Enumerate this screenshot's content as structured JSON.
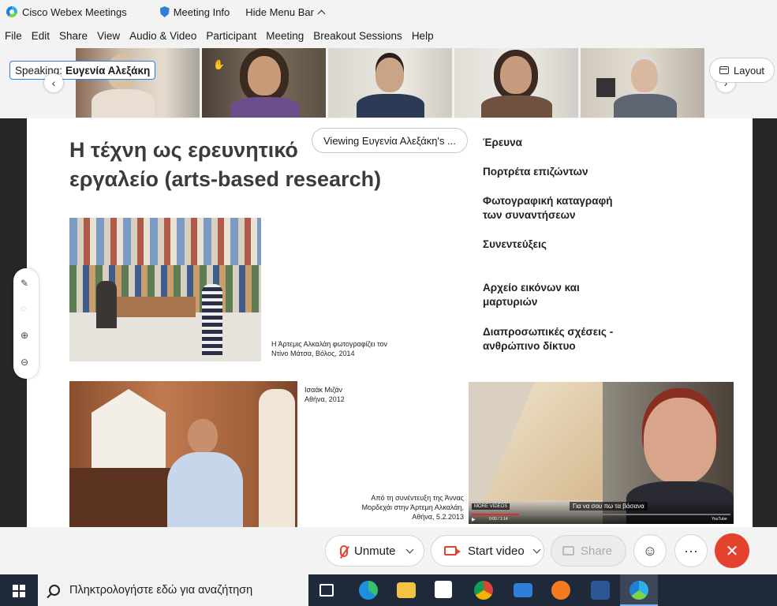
{
  "titlebar": {
    "app_name": "Cisco Webex Meetings",
    "meeting_info": "Meeting Info",
    "hide_menu_bar": "Hide Menu Bar"
  },
  "menubar": [
    "File",
    "Edit",
    "Share",
    "View",
    "Audio & Video",
    "Participant",
    "Meeting",
    "Breakout Sessions",
    "Help"
  ],
  "strip": {
    "speaking_prefix": "Speaking:",
    "speaking_name": "Ευγενία Αλεξάκη",
    "layout_label": "Layout"
  },
  "share": {
    "viewing_label": "Viewing Ευγενία Αλεξάκη's ..."
  },
  "slide": {
    "title_line1": "Η τέχνη ως ερευνητικό",
    "title_line2": "εργαλείο (arts-based research)",
    "list": [
      "Έρευνα",
      "Πορτρέτα επιζώντων",
      "Φωτογραφική καταγραφή των συναντήσεων",
      "Συνεντεύξεις",
      "Αρχείο εικόνων και μαρτυριών",
      "Διαπροσωπικές σχέσεις - ανθρώπινο δίκτυο"
    ],
    "caption1_line1": "Η Άρτεμις Αλκαλάη φωτογραφίζει τον",
    "caption1_line2": "Ντίνο Μάτσα, Βόλος, 2014",
    "caption2_line1": "Ισαάκ Μιζάν",
    "caption2_line2": "Αθήνα, 2012",
    "caption3_line1": "Από τη συνέντευξη της Άννας",
    "caption3_line2": "Μορδεχάι στην Άρτεμη Αλκαλάη,",
    "caption3_line3": "Αθήνα, 5.2.2013",
    "video_subtitle": "Για να σου πω τα βάσανα",
    "video_badge": "MORE VIDEOS",
    "video_time": "0:00 / 1:14",
    "video_brand": "YouTube"
  },
  "controls": {
    "unmute": "Unmute",
    "start_video": "Start video",
    "share": "Share",
    "more": "···",
    "end": "✕"
  },
  "taskbar": {
    "search_placeholder": "Πληκτρολογήστε εδώ για αναζήτηση"
  },
  "colors": {
    "accent_blue": "#2b7de9",
    "end_red": "#e3422e",
    "mute_red": "#e0442c",
    "taskbar": "#1e2a3a"
  }
}
